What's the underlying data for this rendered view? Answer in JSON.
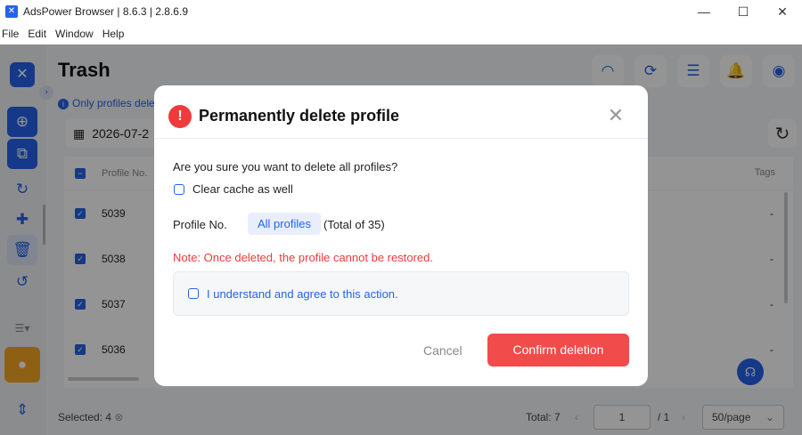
{
  "window": {
    "title": "AdsPower Browser | 8.6.3 | 2.8.6.9",
    "minimize": "—",
    "maximize": "☐",
    "close": "✕"
  },
  "menu": [
    "File",
    "Edit",
    "Window",
    "Help"
  ],
  "page": {
    "title": "Trash",
    "notice": "Only profiles dele",
    "date": "2026-07-2"
  },
  "table": {
    "headers": {
      "profile_no": "Profile No.",
      "tags": "Tags"
    },
    "rows": [
      {
        "no": "5039",
        "tags": "-"
      },
      {
        "no": "5038",
        "tags": "-"
      },
      {
        "no": "5037",
        "tags": "-"
      },
      {
        "no": "5036",
        "tags": "-"
      }
    ]
  },
  "footer": {
    "selected": "Selected: 4",
    "total": "Total: 7",
    "page_input": "1",
    "page_total": "/ 1",
    "page_size": "50/page"
  },
  "modal": {
    "title": "Permanently delete profile",
    "question": "Are you sure you want to delete all profiles?",
    "clear_cache": "Clear cache as well",
    "profile_no_label": "Profile No.",
    "profile_pill": "All profiles",
    "profile_total": "(Total of 35)",
    "note": "Note: Once deleted, the profile cannot be restored.",
    "agree": "I understand and agree to this action.",
    "cancel": "Cancel",
    "confirm": "Confirm deletion"
  },
  "colors": {
    "accent": "#2563eb",
    "danger": "#ef3b3b",
    "confirm": "#f24b4b"
  }
}
